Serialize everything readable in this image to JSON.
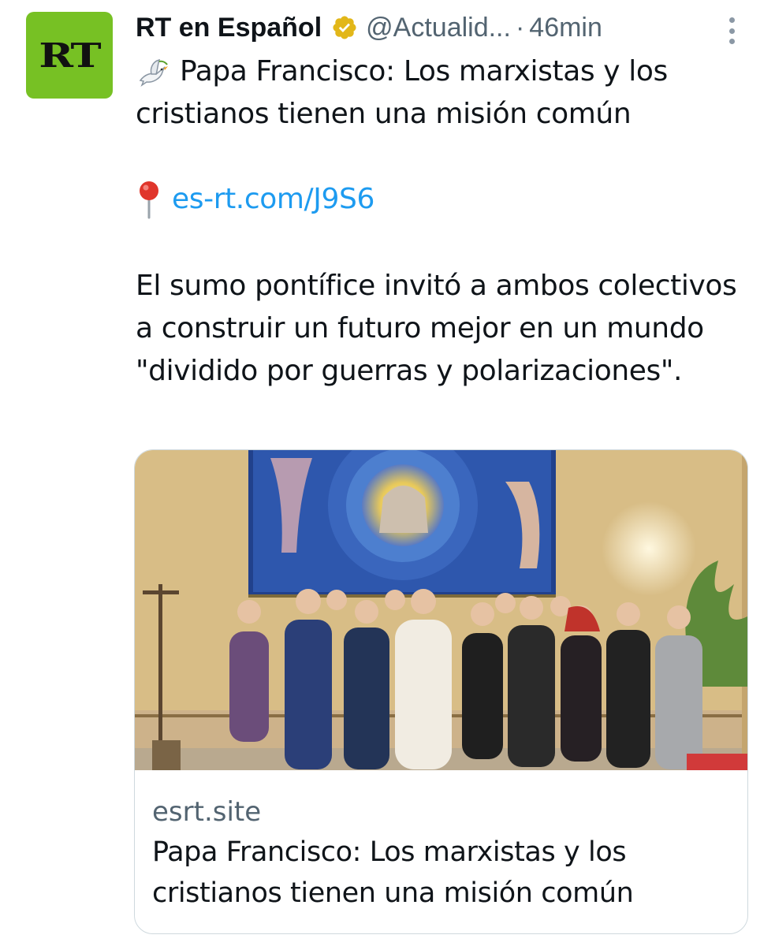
{
  "author": {
    "avatar_text": "RT",
    "name": "RT en Español",
    "handle": "@Actualid...",
    "separator": "·",
    "time": "46min",
    "verified": true,
    "brand_color": "#77c124"
  },
  "tweet": {
    "line1_emoji": "dove-icon",
    "line1": "Papa Francisco: Los marxistas y los cristianos tienen una misión común",
    "link_emoji": "pin-icon",
    "link_text": "es-rt.com/J9S6",
    "line3": "El sumo pontífice invitó a ambos colectivos a construir un futuro mejor en un mundo \"dividido por guerras y polarizaciones\"."
  },
  "card": {
    "domain": "esrt.site",
    "title": "Papa Francisco: Los marxistas y los cristianos tienen una misión común"
  },
  "colors": {
    "link": "#1d9bf0",
    "secondary_text": "#536471",
    "badge_gold": "#e2b719"
  }
}
